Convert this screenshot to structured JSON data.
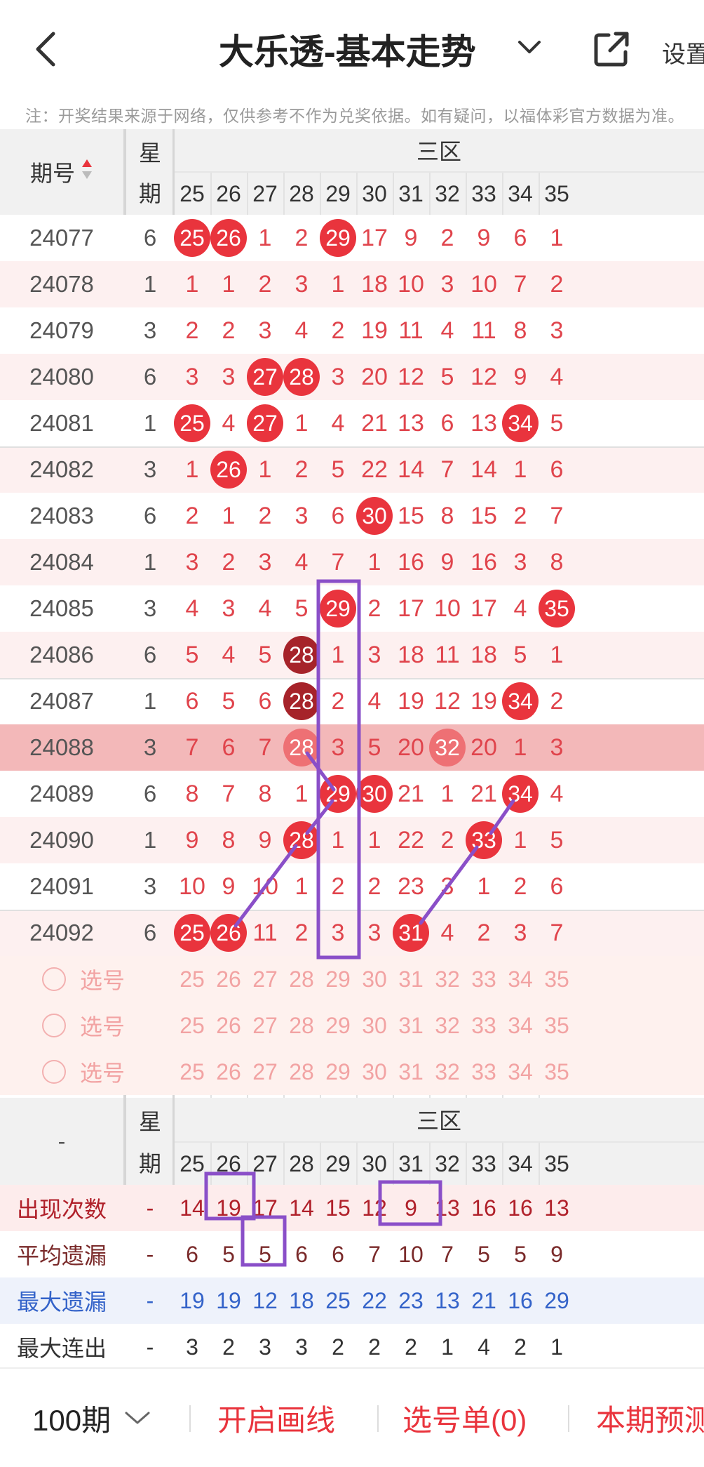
{
  "header": {
    "title": "大乐透-基本走势",
    "settings_label": "设置"
  },
  "notice": "注：开奖结果来源于网络，仅供参考不作为兑奖依据。如有疑问，以福体彩官方数据为准。",
  "table": {
    "col_issue": "期号",
    "col_week_top": "星",
    "col_week_bottom": "期",
    "zone_label": "三区",
    "numbers": [
      "25",
      "26",
      "27",
      "28",
      "29",
      "30",
      "31",
      "32",
      "33",
      "34",
      "35"
    ],
    "rows": [
      {
        "issue": "24077",
        "week": "6",
        "cells": [
          "25",
          "26",
          "1",
          "2",
          "29",
          "17",
          "9",
          "2",
          "9",
          "6",
          "1"
        ],
        "hits": [
          0,
          1,
          4
        ]
      },
      {
        "issue": "24078",
        "week": "1",
        "cells": [
          "1",
          "1",
          "2",
          "3",
          "1",
          "18",
          "10",
          "3",
          "10",
          "7",
          "2"
        ],
        "hits": []
      },
      {
        "issue": "24079",
        "week": "3",
        "cells": [
          "2",
          "2",
          "3",
          "4",
          "2",
          "19",
          "11",
          "4",
          "11",
          "8",
          "3"
        ],
        "hits": []
      },
      {
        "issue": "24080",
        "week": "6",
        "cells": [
          "3",
          "3",
          "27",
          "28",
          "3",
          "20",
          "12",
          "5",
          "12",
          "9",
          "4"
        ],
        "hits": [
          2,
          3
        ]
      },
      {
        "issue": "24081",
        "week": "1",
        "cells": [
          "25",
          "4",
          "27",
          "1",
          "4",
          "21",
          "13",
          "6",
          "13",
          "34",
          "5"
        ],
        "hits": [
          0,
          2,
          9
        ]
      },
      {
        "issue": "24082",
        "week": "3",
        "cells": [
          "1",
          "26",
          "1",
          "2",
          "5",
          "22",
          "14",
          "7",
          "14",
          "1",
          "6"
        ],
        "hits": [
          1
        ]
      },
      {
        "issue": "24083",
        "week": "6",
        "cells": [
          "2",
          "1",
          "2",
          "3",
          "6",
          "30",
          "15",
          "8",
          "15",
          "2",
          "7"
        ],
        "hits": [
          5
        ]
      },
      {
        "issue": "24084",
        "week": "1",
        "cells": [
          "3",
          "2",
          "3",
          "4",
          "7",
          "1",
          "16",
          "9",
          "16",
          "3",
          "8"
        ],
        "hits": []
      },
      {
        "issue": "24085",
        "week": "3",
        "cells": [
          "4",
          "3",
          "4",
          "5",
          "29",
          "2",
          "17",
          "10",
          "17",
          "4",
          "35"
        ],
        "hits": [
          4,
          10
        ]
      },
      {
        "issue": "24086",
        "week": "6",
        "cells": [
          "5",
          "4",
          "5",
          "28",
          "1",
          "3",
          "18",
          "11",
          "18",
          "5",
          "1"
        ],
        "hits": [
          3
        ],
        "dark": [
          3
        ]
      },
      {
        "issue": "24087",
        "week": "1",
        "cells": [
          "6",
          "5",
          "6",
          "28",
          "2",
          "4",
          "19",
          "12",
          "19",
          "34",
          "2"
        ],
        "hits": [
          3,
          9
        ],
        "dark": [
          3
        ]
      },
      {
        "issue": "24088",
        "week": "3",
        "cells": [
          "7",
          "6",
          "7",
          "28",
          "3",
          "5",
          "20",
          "32",
          "20",
          "1",
          "3"
        ],
        "hits": [
          3,
          7
        ],
        "highlight": true
      },
      {
        "issue": "24089",
        "week": "6",
        "cells": [
          "8",
          "7",
          "8",
          "1",
          "29",
          "30",
          "21",
          "1",
          "21",
          "34",
          "4"
        ],
        "hits": [
          4,
          5,
          9
        ]
      },
      {
        "issue": "24090",
        "week": "1",
        "cells": [
          "9",
          "8",
          "9",
          "28",
          "1",
          "1",
          "22",
          "2",
          "33",
          "1",
          "5"
        ],
        "hits": [
          3,
          8
        ]
      },
      {
        "issue": "24091",
        "week": "3",
        "cells": [
          "10",
          "9",
          "10",
          "1",
          "2",
          "2",
          "23",
          "3",
          "1",
          "2",
          "6"
        ],
        "hits": []
      },
      {
        "issue": "24092",
        "week": "6",
        "cells": [
          "25",
          "26",
          "11",
          "2",
          "3",
          "3",
          "31",
          "4",
          "2",
          "3",
          "7"
        ],
        "hits": [
          0,
          1,
          6
        ]
      }
    ],
    "select_label": "选号"
  },
  "stats": {
    "dash": "-",
    "col_week_top": "星",
    "col_week_bottom": "期",
    "zone_label": "三区",
    "rows": [
      {
        "label": "出现次数",
        "dash": "-",
        "values": [
          "14",
          "19",
          "17",
          "14",
          "15",
          "12",
          "9",
          "13",
          "16",
          "16",
          "13"
        ],
        "color": "#b0202a"
      },
      {
        "label": "平均遗漏",
        "dash": "-",
        "values": [
          "6",
          "5",
          "5",
          "6",
          "6",
          "7",
          "10",
          "7",
          "5",
          "5",
          "9"
        ],
        "color": "#7a2a2a"
      },
      {
        "label": "最大遗漏",
        "dash": "-",
        "values": [
          "19",
          "19",
          "12",
          "18",
          "25",
          "22",
          "23",
          "13",
          "21",
          "16",
          "29"
        ],
        "color": "#3463c9"
      },
      {
        "label": "最大连出",
        "dash": "-",
        "values": [
          "3",
          "2",
          "3",
          "3",
          "2",
          "2",
          "2",
          "1",
          "4",
          "2",
          "1"
        ],
        "color": "#333333"
      }
    ]
  },
  "footer": {
    "period": "100期",
    "draw_line": "开启画线",
    "pick_list": "选号单(0)",
    "forecast": "本期预测"
  },
  "colors": {
    "red": "#e9343d",
    "accent_purple": "#8a4fc8"
  }
}
